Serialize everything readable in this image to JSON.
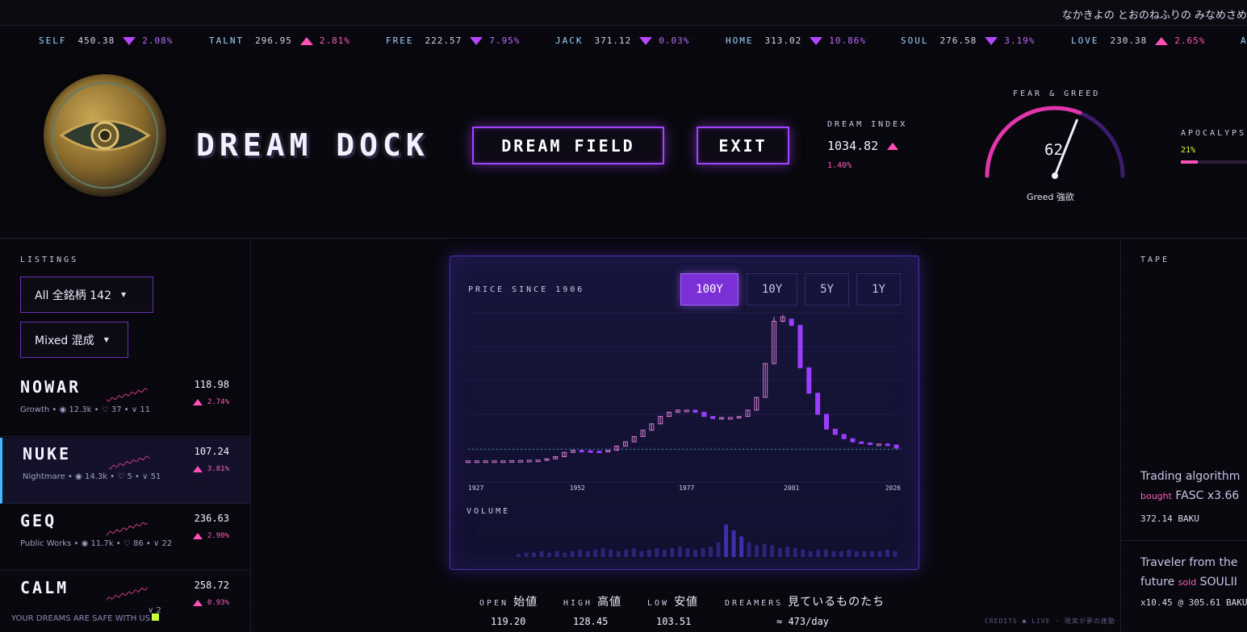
{
  "marquee": {
    "text": "なかきよの とおのねふりの みなめさめ"
  },
  "tickers": [
    {
      "symbol": "SELF",
      "price": "450.38",
      "dir": "down",
      "change": "2.08%"
    },
    {
      "symbol": "TALNT",
      "price": "296.95",
      "dir": "up",
      "change": "2.81%"
    },
    {
      "symbol": "FREE",
      "price": "222.57",
      "dir": "down",
      "change": "7.95%"
    },
    {
      "symbol": "JACK",
      "price": "371.12",
      "dir": "down",
      "change": "0.03%"
    },
    {
      "symbol": "HOME",
      "price": "313.02",
      "dir": "down",
      "change": "10.86%"
    },
    {
      "symbol": "SOUL",
      "price": "276.58",
      "dir": "down",
      "change": "3.19%"
    },
    {
      "symbol": "LOVE",
      "price": "230.38",
      "dir": "up",
      "change": "2.65%"
    },
    {
      "symbol": "A",
      "price": "",
      "dir": "",
      "change": ""
    }
  ],
  "header": {
    "brand": "DREAM DOCK",
    "dream_field_button": "DREAM FIELD",
    "exit_button": "EXIT",
    "dream_index": {
      "label": "DREAM INDEX",
      "value": "1034.82",
      "change": "1.40%"
    },
    "fear_greed": {
      "label": "FEAR & GREED",
      "value": "62",
      "caption": "Greed 強欲",
      "fraction": 0.62
    },
    "apocalypse": {
      "label": "APOCALYPSE",
      "value": "21%",
      "fraction": 0.21
    }
  },
  "listings": {
    "label": "LISTINGS",
    "filter_all": "All 全銘柄 142",
    "filter_mixed": "Mixed 混成",
    "rows": [
      {
        "name": "NOWAR",
        "category": "Growth",
        "views": "12.3k",
        "likes": "37",
        "ratings": "11",
        "price": "118.98",
        "change": "2.74%"
      },
      {
        "name": "NUKE",
        "category": "Nightmare",
        "views": "14.3k",
        "likes": "5",
        "ratings": "51",
        "price": "107.24",
        "change": "3.81%"
      },
      {
        "name": "GEQ",
        "category": "Public Works",
        "views": "11.7k",
        "likes": "86",
        "ratings": "22",
        "price": "236.63",
        "change": "2.90%"
      },
      {
        "name": "CALM",
        "category": "",
        "views": "",
        "likes": "",
        "ratings": "2",
        "price": "258.72",
        "change": "0.93%"
      }
    ],
    "footer_ticker": "YOUR DREAMS ARE SAFE WITH US"
  },
  "chart": {
    "title": "PRICE SINCE 1906",
    "ranges": [
      "100Y",
      "10Y",
      "5Y",
      "1Y"
    ],
    "active_range": "100Y",
    "volume_label": "VOLUME"
  },
  "chart_data": {
    "type": "candlestick",
    "title": "PRICE SINCE 1906",
    "x_ticks": [
      "1927",
      "1952",
      "1977",
      "2001",
      "2026"
    ],
    "x_range": [
      1927,
      2026
    ],
    "y_range": [
      0,
      800
    ],
    "reference_line": 155,
    "candles": [
      {
        "x": 1927,
        "o": 100,
        "c": 100,
        "h": 101,
        "l": 99
      },
      {
        "x": 1929,
        "o": 100,
        "c": 100,
        "h": 101,
        "l": 99
      },
      {
        "x": 1931,
        "o": 100,
        "c": 100,
        "h": 101,
        "l": 99
      },
      {
        "x": 1933,
        "o": 100,
        "c": 100,
        "h": 101,
        "l": 99
      },
      {
        "x": 1935,
        "o": 100,
        "c": 100,
        "h": 101,
        "l": 99
      },
      {
        "x": 1937,
        "o": 100,
        "c": 101,
        "h": 102,
        "l": 99
      },
      {
        "x": 1939,
        "o": 101,
        "c": 102,
        "h": 103,
        "l": 100
      },
      {
        "x": 1941,
        "o": 102,
        "c": 103,
        "h": 104,
        "l": 101
      },
      {
        "x": 1943,
        "o": 103,
        "c": 104,
        "h": 105,
        "l": 102
      },
      {
        "x": 1945,
        "o": 104,
        "c": 110,
        "h": 112,
        "l": 103
      },
      {
        "x": 1947,
        "o": 110,
        "c": 120,
        "h": 122,
        "l": 109
      },
      {
        "x": 1949,
        "o": 120,
        "c": 140,
        "h": 142,
        "l": 119
      },
      {
        "x": 1951,
        "o": 140,
        "c": 150,
        "h": 152,
        "l": 139
      },
      {
        "x": 1953,
        "o": 150,
        "c": 148,
        "h": 151,
        "l": 146
      },
      {
        "x": 1955,
        "o": 148,
        "c": 146,
        "h": 149,
        "l": 145
      },
      {
        "x": 1957,
        "o": 146,
        "c": 144,
        "h": 147,
        "l": 143
      },
      {
        "x": 1959,
        "o": 144,
        "c": 150,
        "h": 152,
        "l": 143
      },
      {
        "x": 1961,
        "o": 150,
        "c": 170,
        "h": 172,
        "l": 149
      },
      {
        "x": 1963,
        "o": 170,
        "c": 190,
        "h": 192,
        "l": 169
      },
      {
        "x": 1965,
        "o": 190,
        "c": 215,
        "h": 217,
        "l": 189
      },
      {
        "x": 1967,
        "o": 215,
        "c": 245,
        "h": 247,
        "l": 214
      },
      {
        "x": 1969,
        "o": 245,
        "c": 275,
        "h": 277,
        "l": 244
      },
      {
        "x": 1971,
        "o": 275,
        "c": 310,
        "h": 312,
        "l": 274
      },
      {
        "x": 1973,
        "o": 310,
        "c": 330,
        "h": 332,
        "l": 309
      },
      {
        "x": 1975,
        "o": 330,
        "c": 340,
        "h": 342,
        "l": 329
      },
      {
        "x": 1977,
        "o": 340,
        "c": 340,
        "h": 342,
        "l": 338
      },
      {
        "x": 1979,
        "o": 340,
        "c": 330,
        "h": 341,
        "l": 328
      },
      {
        "x": 1981,
        "o": 330,
        "c": 310,
        "h": 331,
        "l": 308
      },
      {
        "x": 1983,
        "o": 310,
        "c": 300,
        "h": 311,
        "l": 298
      },
      {
        "x": 1985,
        "o": 300,
        "c": 305,
        "h": 307,
        "l": 298
      },
      {
        "x": 1987,
        "o": 305,
        "c": 305,
        "h": 307,
        "l": 303
      },
      {
        "x": 1989,
        "o": 305,
        "c": 310,
        "h": 312,
        "l": 304
      },
      {
        "x": 1991,
        "o": 310,
        "c": 340,
        "h": 342,
        "l": 309
      },
      {
        "x": 1993,
        "o": 340,
        "c": 400,
        "h": 402,
        "l": 339
      },
      {
        "x": 1995,
        "o": 400,
        "c": 560,
        "h": 562,
        "l": 399
      },
      {
        "x": 1997,
        "o": 560,
        "c": 760,
        "h": 780,
        "l": 559
      },
      {
        "x": 1999,
        "o": 760,
        "c": 780,
        "h": 790,
        "l": 755
      },
      {
        "x": 2001,
        "o": 770,
        "c": 740,
        "h": 772,
        "l": 738
      },
      {
        "x": 2003,
        "o": 740,
        "c": 540,
        "h": 741,
        "l": 538
      },
      {
        "x": 2005,
        "o": 540,
        "c": 420,
        "h": 541,
        "l": 418
      },
      {
        "x": 2007,
        "o": 420,
        "c": 320,
        "h": 421,
        "l": 318
      },
      {
        "x": 2009,
        "o": 320,
        "c": 250,
        "h": 321,
        "l": 248
      },
      {
        "x": 2011,
        "o": 250,
        "c": 225,
        "h": 251,
        "l": 223
      },
      {
        "x": 2013,
        "o": 225,
        "c": 205,
        "h": 226,
        "l": 203
      },
      {
        "x": 2015,
        "o": 205,
        "c": 190,
        "h": 206,
        "l": 188
      },
      {
        "x": 2017,
        "o": 190,
        "c": 185,
        "h": 191,
        "l": 183
      },
      {
        "x": 2019,
        "o": 185,
        "c": 180,
        "h": 186,
        "l": 178
      },
      {
        "x": 2021,
        "o": 180,
        "c": 180,
        "h": 182,
        "l": 178
      },
      {
        "x": 2023,
        "o": 180,
        "c": 175,
        "h": 181,
        "l": 173
      },
      {
        "x": 2025,
        "o": 175,
        "c": 160,
        "h": 176,
        "l": 158
      }
    ],
    "volume": [
      2,
      3,
      3,
      4,
      3,
      4,
      3,
      4,
      5,
      4,
      5,
      6,
      5,
      4,
      5,
      6,
      4,
      5,
      6,
      5,
      6,
      7,
      6,
      5,
      6,
      7,
      10,
      22,
      18,
      14,
      10,
      8,
      9,
      8,
      6,
      7,
      6,
      5,
      4,
      5,
      5,
      4,
      4,
      5,
      4,
      4,
      4,
      4,
      5,
      4
    ],
    "stats": [
      {
        "label": "OPEN",
        "label_jp": "始値",
        "value": "119.20"
      },
      {
        "label": "HIGH",
        "label_jp": "高値",
        "value": "128.45"
      },
      {
        "label": "LOW",
        "label_jp": "安値",
        "value": "103.51"
      },
      {
        "label": "DREAMERS",
        "label_jp": "見ているものたち",
        "value": "≈ 473/day"
      }
    ]
  },
  "tape": {
    "label": "TAPE",
    "entries": [
      {
        "line1": "Trading algorithm",
        "action": "bought",
        "line2": "FASC x3.66",
        "line3": "372.14 BAKU"
      },
      {
        "line1": "Traveler from the",
        "line1b": "future",
        "action": "sold",
        "line2": "SOULII",
        "line3": "x10.45 @ 305.61 BAKU"
      }
    ]
  },
  "footer": {
    "credits": "CREDITS ● LIVE · 現実が夢の連動"
  },
  "colors": {
    "accent_purple": "#a244ff",
    "accent_pink": "#ff4fb7",
    "accent_blue": "#3fb8ff",
    "bg": "#07060c"
  }
}
